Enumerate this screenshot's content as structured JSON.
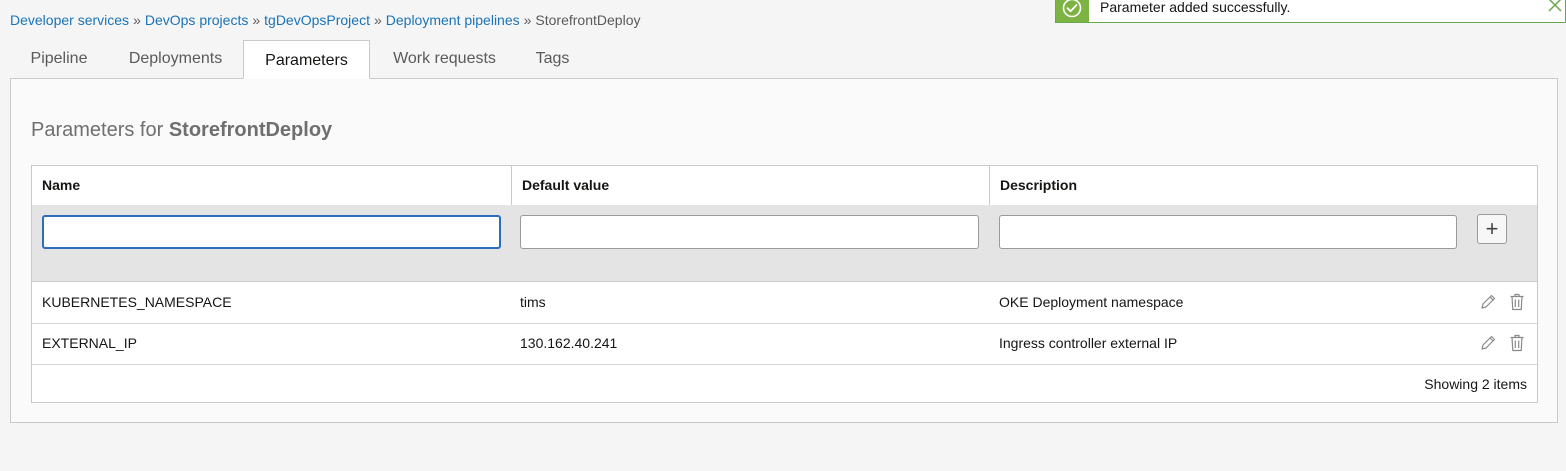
{
  "breadcrumb": {
    "items": [
      "Developer services",
      "DevOps projects",
      "tgDevOpsProject",
      "Deployment pipelines"
    ],
    "current": "StorefrontDeploy",
    "separator": "»"
  },
  "toast": {
    "message": "Parameter added successfully."
  },
  "tabs": [
    "Pipeline",
    "Deployments",
    "Parameters",
    "Work requests",
    "Tags"
  ],
  "panel": {
    "title_prefix": "Parameters for",
    "title_name": "StorefrontDeploy"
  },
  "table": {
    "columns": [
      "Name",
      "Default value",
      "Description"
    ],
    "new_row": {
      "name": "",
      "default_value": "",
      "description": ""
    },
    "add_label": "+",
    "rows": [
      {
        "name": "KUBERNETES_NAMESPACE",
        "value": "tims",
        "description": "OKE Deployment namespace"
      },
      {
        "name": "EXTERNAL_IP",
        "value": "130.162.40.241",
        "description": "Ingress controller external IP"
      }
    ],
    "footer": "Showing 2 items"
  },
  "colors": {
    "link": "#1a73b8",
    "success": "#7cb342",
    "focus": "#2a6ebb"
  }
}
